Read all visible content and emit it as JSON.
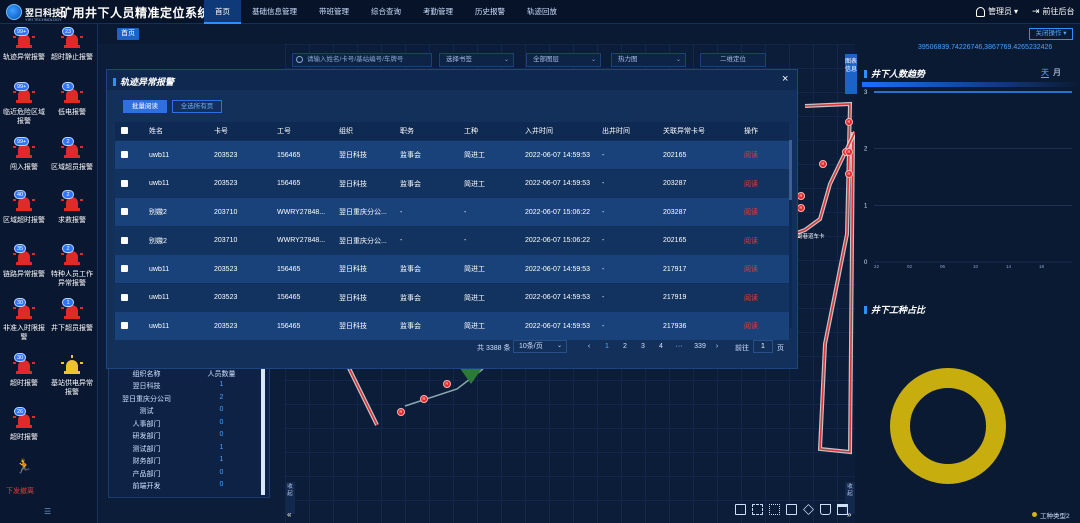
{
  "header": {
    "logo_text": "翌日科技",
    "logo_sub": "YIRI TECHNOLOGY",
    "title": "矿用井下人员精准定位系统",
    "nav": [
      "首页",
      "基础信息管理",
      "带班管理",
      "综合查询",
      "考勤管理",
      "历史报警",
      "轨迹回放"
    ],
    "user": "管理员",
    "user_chev": "▾",
    "goto": "前往后台"
  },
  "sidebar": {
    "alarms": [
      {
        "label": "轨迹异常报警",
        "badge": "99+"
      },
      {
        "label": "超时静止报警",
        "badge": "23"
      },
      {
        "label": "临近危险区域报警",
        "badge": "99+"
      },
      {
        "label": "低电报警",
        "badge": "5"
      },
      {
        "label": "闯入报警",
        "badge": "99+"
      },
      {
        "label": "区域超员报警",
        "badge": "2"
      },
      {
        "label": "区域超时报警",
        "badge": "40"
      },
      {
        "label": "求救报警",
        "badge": "2"
      },
      {
        "label": "链路异常报警",
        "badge": "35"
      },
      {
        "label": "特种人员工作异常报警",
        "badge": "2"
      },
      {
        "label": "非准入时限报警",
        "badge": "30"
      },
      {
        "label": "井下超员报警",
        "badge": "1"
      },
      {
        "label": "超时报警",
        "badge": "30"
      },
      {
        "label": "基站供电异常报警",
        "badge": ""
      },
      {
        "label": "超时报警",
        "badge": "26"
      }
    ],
    "evacuate": "下发撤离",
    "collapse": "☰"
  },
  "breadcrumb": {
    "home": "首页"
  },
  "action_menu": "关闭操作 ▾",
  "coords": "39506839.74226746,3867769.4265232426",
  "toolbar": {
    "search_placeholder": "请输入姓名/卡号/基站编号/车牌号",
    "select_tag": "选择书签",
    "all_floors": "全部图层",
    "heatmap": "热力图",
    "qr": "二维定位",
    "chev": "⌄"
  },
  "map": {
    "info_tab": "图表信息",
    "label_road": "副巷道车卡",
    "pin_text": "R",
    "tab_left": "收起",
    "tab_right": "收起",
    "arrows_left": "«",
    "arrows_right": "»",
    "tools": [
      "定位",
      "全屏",
      "框选",
      "复制",
      "测距",
      "清除",
      "图层"
    ]
  },
  "right": {
    "trend_title": "井下人数趋势",
    "tab_day": "天",
    "tab_month": "月",
    "trend_chart": {
      "y_ticks": [
        "3",
        "2",
        "1",
        "0"
      ],
      "x_ticks": [
        "22",
        "02",
        "06",
        "10",
        "14",
        "18"
      ]
    },
    "pie_title": "井下工种占比",
    "legend": "工种类型2"
  },
  "org": {
    "head": [
      "组织名称",
      "人员数量"
    ],
    "rows": [
      {
        "name": "翌日科技",
        "count": "1"
      },
      {
        "name": "翌日重庆分公司",
        "count": "2"
      },
      {
        "name": "测试",
        "count": "0"
      },
      {
        "name": "人事部门",
        "count": "0"
      },
      {
        "name": "研发部门",
        "count": "0"
      },
      {
        "name": "测试部门",
        "count": "1"
      },
      {
        "name": "财务部门",
        "count": "1"
      },
      {
        "name": "产品部门",
        "count": "0"
      },
      {
        "name": "前端开发",
        "count": "0"
      }
    ]
  },
  "modal": {
    "title": "轨迹异常报警",
    "close": "×",
    "btn_batch": "批量阅读",
    "btn_all": "全选所有页",
    "columns": [
      "",
      "姓名",
      "卡号",
      "工号",
      "组织",
      "职务",
      "工种",
      "入井时间",
      "出井时间",
      "关联异常卡号",
      "操作"
    ],
    "rows": [
      [
        "uwb11",
        "203523",
        "156465",
        "翌日科技",
        "监事会",
        "简进工",
        "2022-06-07 14:59:53",
        "-",
        "202165",
        "阅读"
      ],
      [
        "uwb11",
        "203523",
        "156465",
        "翌日科技",
        "监事会",
        "简进工",
        "2022-06-07 14:59:53",
        "-",
        "203287",
        "阅读"
      ],
      [
        "别嫐2",
        "203710",
        "WWRY27848...",
        "翌日重庆分公...",
        "-",
        "-",
        "2022-06-07 15:06:22",
        "-",
        "203287",
        "阅读"
      ],
      [
        "别嫐2",
        "203710",
        "WWRY27848...",
        "翌日重庆分公...",
        "-",
        "-",
        "2022-06-07 15:06:22",
        "-",
        "202165",
        "阅读"
      ],
      [
        "uwb11",
        "203523",
        "156465",
        "翌日科技",
        "监事会",
        "简进工",
        "2022-06-07 14:59:53",
        "-",
        "217917",
        "阅读"
      ],
      [
        "uwb11",
        "203523",
        "156465",
        "翌日科技",
        "监事会",
        "简进工",
        "2022-06-07 14:59:53",
        "-",
        "217919",
        "阅读"
      ],
      [
        "uwb11",
        "203523",
        "156465",
        "翌日科技",
        "监事会",
        "简进工",
        "2022-06-07 14:59:53",
        "-",
        "217936",
        "阅读"
      ]
    ],
    "pager": {
      "total": "共 3388 条",
      "page_size": "10条/页",
      "prev": "‹",
      "pages": [
        "1",
        "2",
        "3",
        "4",
        "···",
        "339"
      ],
      "next": "›",
      "goto": "前往",
      "current": "1",
      "unit": "页"
    }
  },
  "colors": {
    "accent": "#2f8fff",
    "danger": "#e02a2a",
    "pie": "#c8ad0f"
  }
}
